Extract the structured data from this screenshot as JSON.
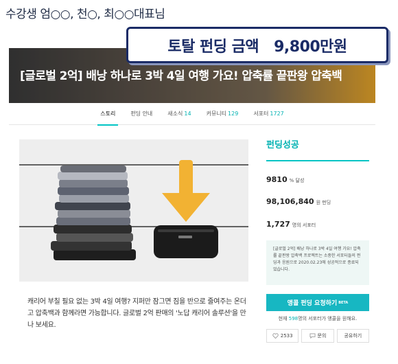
{
  "caption": "수강생 엄○○, 천○, 최○○대표님",
  "total": {
    "label": "토탈 펀딩 금액",
    "value": "9,800만원"
  },
  "hero": {
    "title": "[글로벌 2억] 배낭 하나로 3박 4일 여행 가요! 압축률 끝판왕 압축백"
  },
  "tabs": [
    {
      "label": "스토리",
      "count": "",
      "active": true
    },
    {
      "label": "펀딩 안내",
      "count": ""
    },
    {
      "label": "새소식",
      "count": "14"
    },
    {
      "label": "커뮤니티",
      "count": "129"
    },
    {
      "label": "서포터",
      "count": "1727"
    }
  ],
  "description": "캐리어 부칠 필요 없는 3박 4일 여행? 지퍼만 잠그면 짐을 반으로 줄여주는 온더고 압축백과 함께라면 가능합니다. 글로벌 2억 판매의 '노답 캐리어 솔루션'을 만나 보세요.",
  "side": {
    "status": "펀딩성공",
    "percent": "9810",
    "percent_unit": "% 달성",
    "amount": "98,106,840",
    "amount_unit": "원 펀딩",
    "supporters": "1,727",
    "supporters_unit": "명의 서포터",
    "notice": "[글로벌 2억] 배낭 하나로 3박 4일 여행 가요! 압축률 끝판왕 압축백 프로젝트는 소중한 서포터들의 펀딩과 응원으로 2020.02.23에 성공적으로 종료되었습니다.",
    "cta_label": "앵콜 펀딩 요청하기",
    "cta_badge": "BETA",
    "encore_prefix": "현재 ",
    "encore_count": "598",
    "encore_suffix": "명의 서포터가 앵콜을 원해요.",
    "like_count": "2533",
    "inquiry_label": "문의",
    "share_label": "공유하기"
  },
  "colors": {
    "accent": "#00c4c4",
    "cta": "#17b7c2",
    "box_border": "#1a2b66",
    "arrow": "#f2b233"
  },
  "icons": {
    "like": "heart-icon",
    "inquiry": "chat-icon"
  }
}
